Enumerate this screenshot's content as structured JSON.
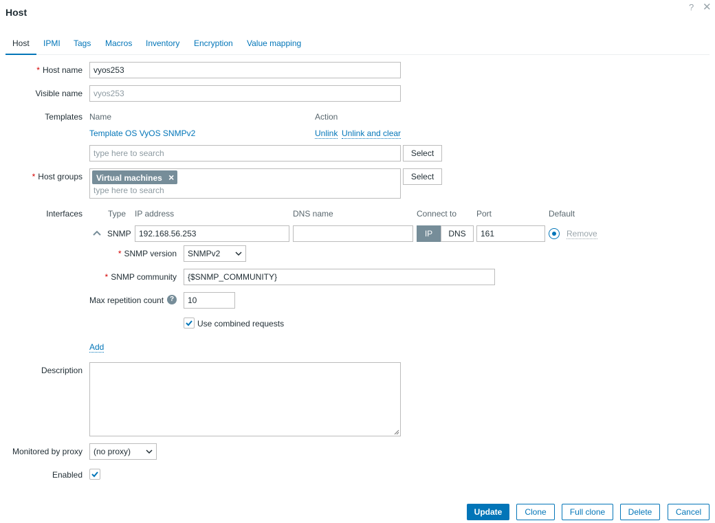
{
  "dialog": {
    "title": "Host",
    "help_icon": "question-icon",
    "close_icon": "close-icon"
  },
  "tabs": [
    {
      "label": "Host",
      "active": true
    },
    {
      "label": "IPMI"
    },
    {
      "label": "Tags"
    },
    {
      "label": "Macros"
    },
    {
      "label": "Inventory"
    },
    {
      "label": "Encryption"
    },
    {
      "label": "Value mapping"
    }
  ],
  "host_name": {
    "label": "Host name",
    "required_mark": "*",
    "value": "vyos253"
  },
  "visible_name": {
    "label": "Visible name",
    "value": "vyos253"
  },
  "templates": {
    "label": "Templates",
    "col_name": "Name",
    "col_action": "Action",
    "linked": {
      "name": "Template OS VyOS SNMPv2",
      "unlink": "Unlink",
      "unlink_clear": "Unlink and clear"
    },
    "search_placeholder": "type here to search",
    "select_label": "Select"
  },
  "host_groups": {
    "label": "Host groups",
    "required_mark": "*",
    "tag": "Virtual machines",
    "tag_remove_icon": "×",
    "search_placeholder": "type here to search",
    "select_label": "Select"
  },
  "interfaces": {
    "label": "Interfaces",
    "col_type": "Type",
    "col_ip": "IP address",
    "col_dns": "DNS name",
    "col_connect": "Connect to",
    "col_port": "Port",
    "col_default": "Default",
    "row": {
      "type": "SNMP",
      "ip": "192.168.56.253",
      "dns": "",
      "connect_ip": "IP",
      "connect_dns": "DNS",
      "port": "161",
      "remove": "Remove"
    },
    "snmp_version": {
      "label": "SNMP version",
      "required_mark": "*",
      "value": "SNMPv2"
    },
    "snmp_community": {
      "label": "SNMP community",
      "required_mark": "*",
      "value": "{$SNMP_COMMUNITY}"
    },
    "max_repetition": {
      "label": "Max repetition count",
      "value": "10",
      "help_icon": "?"
    },
    "combined_requests": {
      "label": "Use combined requests",
      "checked": true
    },
    "add_label": "Add"
  },
  "description": {
    "label": "Description",
    "value": ""
  },
  "proxy": {
    "label": "Monitored by proxy",
    "value": "(no proxy)"
  },
  "enabled": {
    "label": "Enabled",
    "checked": true
  },
  "footer": {
    "update": "Update",
    "clone": "Clone",
    "full_clone": "Full clone",
    "delete": "Delete",
    "cancel": "Cancel"
  },
  "colors": {
    "accent": "#0275b8",
    "required": "#d40000",
    "tag_bg": "#768d99"
  }
}
